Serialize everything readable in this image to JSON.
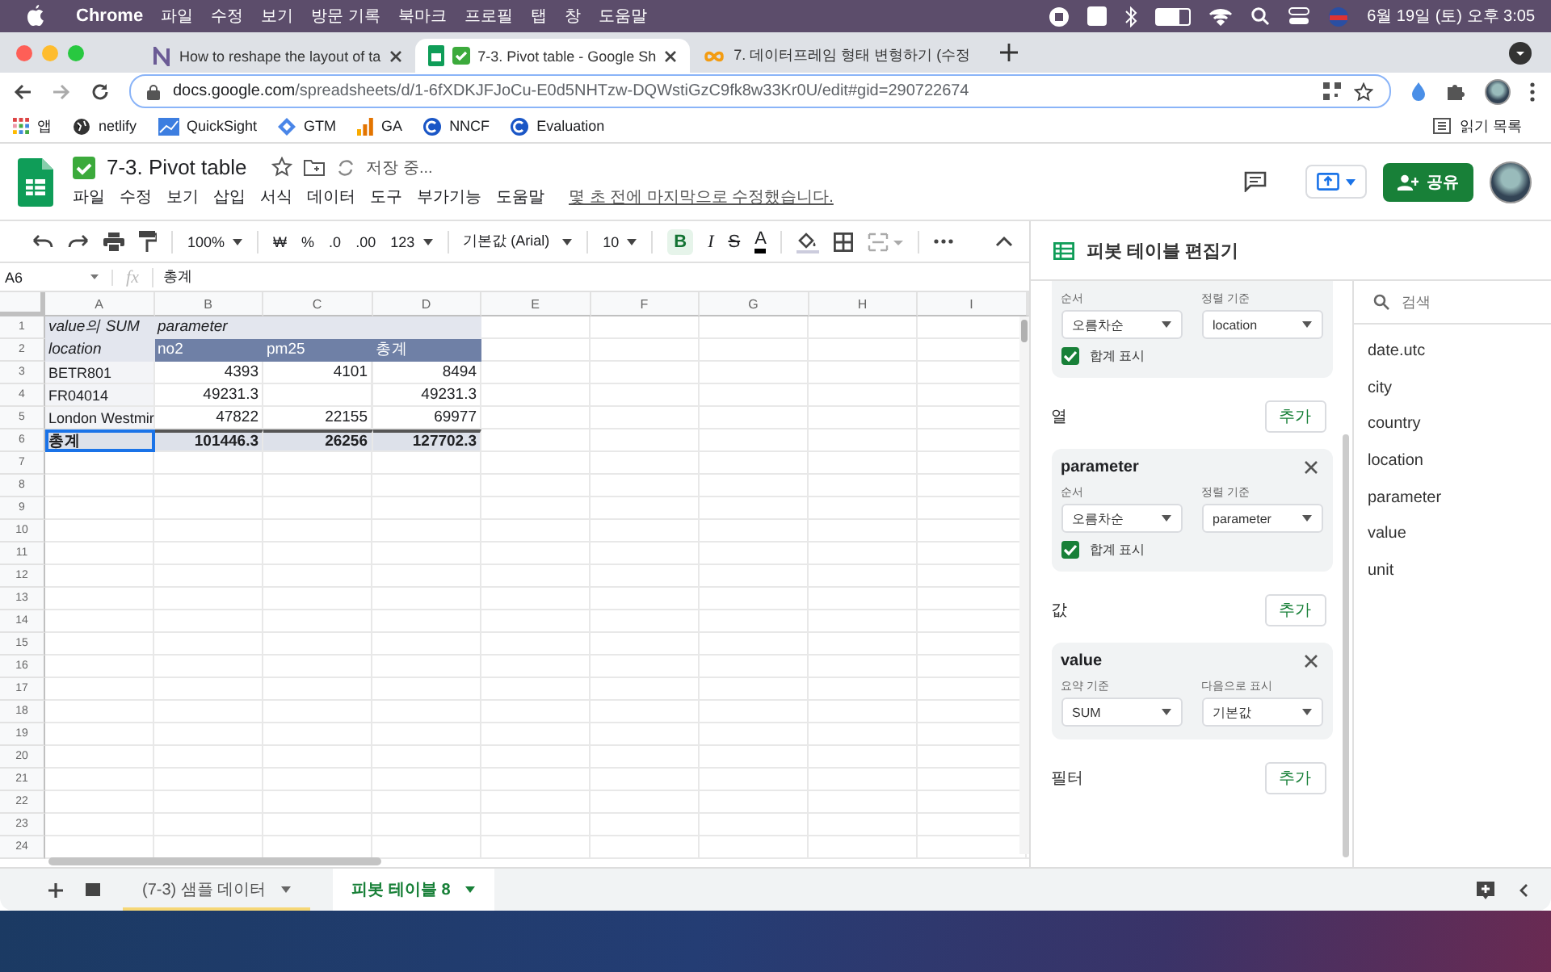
{
  "menubar": {
    "app": "Chrome",
    "items": [
      "파일",
      "수정",
      "보기",
      "방문 기록",
      "북마크",
      "프로필",
      "탭",
      "창",
      "도움말"
    ],
    "clock": "6월 19일 (토) 오후 3:05"
  },
  "browser": {
    "tabs": [
      {
        "title": "How to reshape the layout of ta",
        "selected": false
      },
      {
        "title": "7-3. Pivot table - Google Sh",
        "selected": true
      },
      {
        "title": "7. 데이터프레임 형태 변형하기 (수정",
        "selected": false
      }
    ],
    "url_host": "docs.google.com",
    "url_path": "/spreadsheets/d/1-6fXDKJFJoCu-E0d5NHTzw-DQWstiGzC9fk8w33Kr0U/edit#gid=290722674",
    "bookmarks": [
      "앱",
      "netlify",
      "QuickSight",
      "GTM",
      "GA",
      "NNCF",
      "Evaluation"
    ],
    "reading_list": "읽기 목록"
  },
  "doc": {
    "title": "7-3. Pivot table",
    "saving": "저장 중...",
    "menus": [
      "파일",
      "수정",
      "보기",
      "삽입",
      "서식",
      "데이터",
      "도구",
      "부가기능",
      "도움말"
    ],
    "last_edit": "몇 초 전에 마지막으로 수정했습니다.",
    "share": "공유"
  },
  "toolbar": {
    "zoom": "100%",
    "currency": "₩",
    "percent": "%",
    "decrease_decimal": ".0",
    "increase_decimal": ".00",
    "number_format": "123",
    "font": "기본값 (Arial)",
    "font_size": "10",
    "bold": "B",
    "bold_selected": true,
    "italic": "I",
    "strike": "S",
    "text_color": "A"
  },
  "formula_bar": {
    "cell": "A6",
    "fx": "fx",
    "value": "총계"
  },
  "grid": {
    "columns": [
      "A",
      "B",
      "C",
      "D",
      "E",
      "F",
      "G",
      "H",
      "I"
    ],
    "row_numbers": [
      "1",
      "2",
      "3",
      "4",
      "5",
      "6",
      "7",
      "8",
      "9",
      "10",
      "11",
      "12",
      "13",
      "14",
      "15",
      "16",
      "17",
      "18",
      "19",
      "20",
      "21",
      "22",
      "23",
      "24"
    ],
    "rows": [
      [
        {
          "kind": "corner",
          "text": "value의 SUM",
          "selected": false
        },
        {
          "kind": "corner",
          "text": "parameter",
          "selected": false
        },
        {
          "kind": "corner",
          "selected": false
        },
        {
          "kind": "corner",
          "selected": false
        }
      ],
      [
        {
          "kind": "corner",
          "text": "location",
          "selected": false
        },
        {
          "kind": "colhead",
          "text": "no2",
          "selected": false
        },
        {
          "kind": "colhead",
          "text": "pm25",
          "selected": false
        },
        {
          "kind": "colhead",
          "text": "총계",
          "selected": false
        }
      ],
      [
        {
          "kind": "rowlabel",
          "text": "BETR801",
          "selected": false
        },
        {
          "kind": "num",
          "text": "4393",
          "selected": false
        },
        {
          "kind": "num",
          "text": "4101",
          "selected": false
        },
        {
          "kind": "num",
          "text": "8494",
          "selected": false
        }
      ],
      [
        {
          "kind": "rowlabel",
          "text": "FR04014",
          "selected": false
        },
        {
          "kind": "num",
          "text": "49231.3",
          "selected": false
        },
        {
          "kind": "num",
          "selected": false
        },
        {
          "kind": "num",
          "text": "49231.3",
          "selected": false
        }
      ],
      [
        {
          "kind": "rowlabel",
          "text": "London Westmir",
          "selected": false
        },
        {
          "kind": "num",
          "text": "47822",
          "selected": false
        },
        {
          "kind": "num",
          "text": "22155",
          "selected": false
        },
        {
          "kind": "num",
          "text": "69977",
          "selected": false
        }
      ],
      [
        {
          "kind": "total_label",
          "text": "총계",
          "selected": true
        },
        {
          "kind": "total_num",
          "text": "101446.3",
          "selected": false
        },
        {
          "kind": "total_num",
          "text": "26256",
          "selected": false
        },
        {
          "kind": "total_num",
          "text": "127702.3",
          "selected": false
        }
      ]
    ]
  },
  "pivot_editor": {
    "title": "피봇 테이블 편집기",
    "sections": [
      {
        "cards": [
          {
            "dropdowns": [
              {
                "label": "순서",
                "value": "오름차순"
              },
              {
                "label": "정렬 기준",
                "value": "location"
              }
            ],
            "checkbox": {
              "label": "합계 표시",
              "checked": true
            }
          }
        ]
      },
      {
        "title": "열",
        "add": "추가",
        "cards": [
          {
            "name": "parameter",
            "dropdowns": [
              {
                "label": "순서",
                "value": "오름차순"
              },
              {
                "label": "정렬 기준",
                "value": "parameter"
              }
            ],
            "checkbox": {
              "label": "합계 표시",
              "checked": true
            }
          }
        ]
      },
      {
        "title": "값",
        "add": "추가",
        "cards": [
          {
            "name": "value",
            "dropdowns": [
              {
                "label": "요약 기준",
                "value": "SUM"
              },
              {
                "label": "다음으로 표시",
                "value": "기본값"
              }
            ]
          }
        ]
      },
      {
        "title": "필터",
        "add": "추가"
      }
    ],
    "search_placeholder": "검색",
    "fields": [
      "date.utc",
      "city",
      "country",
      "location",
      "parameter",
      "value",
      "unit"
    ]
  },
  "sheet_tabs": [
    {
      "label": "(7-3) 샘플 데이터",
      "selected": false,
      "color": "#f6d776"
    },
    {
      "label": "피봇 테이블 8",
      "selected": true
    }
  ]
}
